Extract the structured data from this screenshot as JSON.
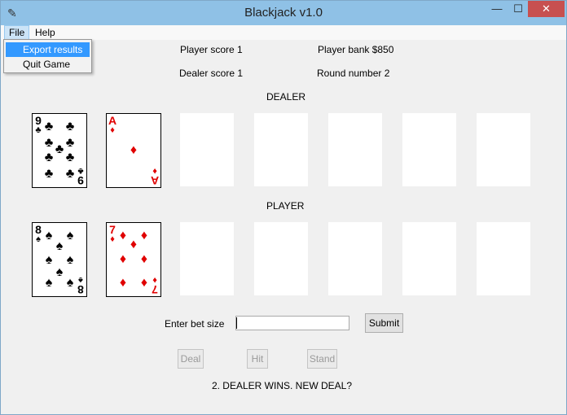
{
  "window": {
    "title": "Blackjack v1.0",
    "icon": "feather-icon",
    "controls": {
      "minimize": "—",
      "maximize": "☐",
      "close": "✕"
    }
  },
  "menubar": {
    "file": "File",
    "help": "Help"
  },
  "file_menu": {
    "items": [
      "Export results",
      "Quit Game"
    ],
    "highlighted": "Export results"
  },
  "scores": {
    "player_score": "Player score 1",
    "dealer_score": "Dealer score 1",
    "player_bank": "Player bank $850",
    "round_number": "Round number 2"
  },
  "dealer": {
    "label": "DEALER",
    "cards": [
      {
        "rank": "9",
        "suit": "♣",
        "color": "#000000"
      },
      {
        "rank": "A",
        "suit": "♦",
        "color": "#e00000"
      }
    ],
    "empty_slots": 5
  },
  "player": {
    "label": "PLAYER",
    "cards": [
      {
        "rank": "8",
        "suit": "♠",
        "color": "#000000"
      },
      {
        "rank": "7",
        "suit": "♦",
        "color": "#e00000"
      }
    ],
    "empty_slots": 5
  },
  "bet": {
    "label": "Enter bet size",
    "value": "",
    "submit": "Submit"
  },
  "actions": {
    "deal": "Deal",
    "hit": "Hit",
    "stand": "Stand"
  },
  "status": "2. DEALER WINS. NEW DEAL?"
}
